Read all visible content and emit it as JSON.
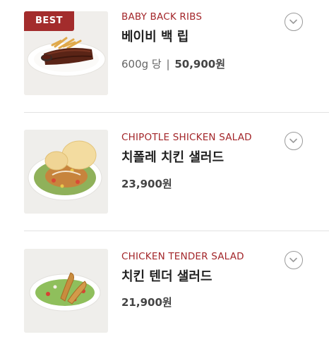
{
  "menu": {
    "items": [
      {
        "badge": "BEST",
        "name_en": "BABY BACK RIBS",
        "name_ko": "베이비 백 립",
        "unit": "600g 당",
        "separator": "|",
        "price": "50,900원",
        "image_icon": "ribs-plate-image",
        "expand_icon": "chevron-down-icon"
      },
      {
        "name_en": "CHIPOTLE SHICKEN SALAD",
        "name_ko": "치폴레 치킨 샐러드",
        "price": "23,900원",
        "image_icon": "chipotle-salad-image",
        "expand_icon": "chevron-down-icon"
      },
      {
        "name_en": "CHICKEN TENDER SALAD",
        "name_ko": "치킨 텐더 샐러드",
        "price": "21,900원",
        "image_icon": "tender-salad-image",
        "expand_icon": "chevron-down-icon"
      }
    ]
  },
  "colors": {
    "accent_red": "#a3262a",
    "badge_bg": "#a32c2c",
    "title_text": "#222222",
    "price_text": "#555555",
    "divider": "#e2e2e2",
    "thumb_bg": "#f1efec"
  }
}
